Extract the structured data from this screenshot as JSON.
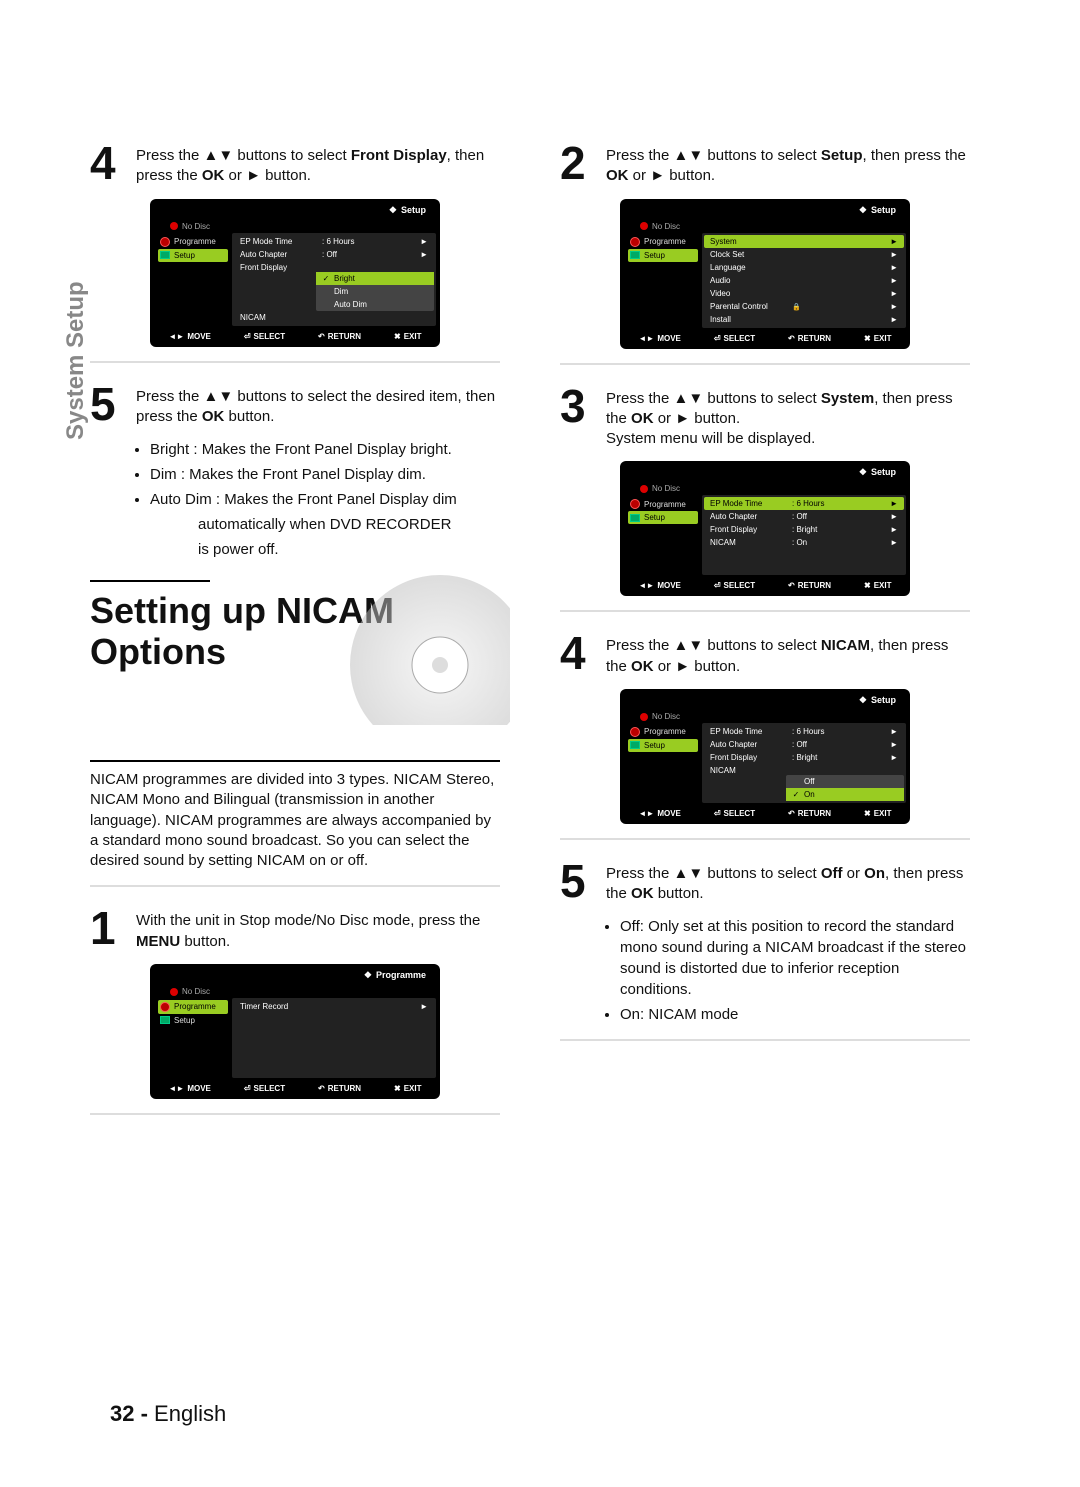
{
  "sideTab": "System Setup",
  "page": {
    "number": "32 -",
    "language": "English"
  },
  "icons": {
    "updown": "▲▼",
    "right": "►",
    "diamond": "❖"
  },
  "footer": {
    "move": "MOVE",
    "movesym": "◄►",
    "select": "SELECT",
    "selectsym": "⏎",
    "return": "RETURN",
    "returnsym": "↶",
    "exit": "EXIT",
    "exitsym": "✖"
  },
  "osdLabels": {
    "noDisc": "No Disc",
    "programme": "Programme",
    "setup": "Setup",
    "setupTitle": "Setup",
    "programmeTitle": "Programme",
    "system": "System",
    "clockSet": "Clock Set",
    "language": "Language",
    "audio": "Audio",
    "video": "Video",
    "parental": "Parental Control",
    "install": "Install",
    "timerRecord": "Timer Record",
    "epMode": "EP Mode Time",
    "autoChapter": "Auto Chapter",
    "frontDisplay": "Front Display",
    "nicam": "NICAM",
    "bright": "Bright",
    "dim": "Dim",
    "autoDim": "Auto Dim",
    "off": "Off",
    "on": "On",
    "v6h": ": 6 Hours",
    "vOff": ": Off",
    "vBright": ": Bright",
    "vOn": ": On"
  },
  "left": {
    "s4": {
      "num": "4",
      "pre": "Press the ",
      "mid1": " buttons to select ",
      "bold1": "Front Display",
      "mid2": ", then press the ",
      "bold2": "OK",
      "mid3": " or ",
      "mid4": " button."
    },
    "s5": {
      "num": "5",
      "pre": "Press the ",
      "mid1": " buttons to select the desired item, then press the ",
      "bold1": "OK",
      "mid2": " button."
    },
    "bullets": {
      "b1b": "Bright",
      "b1": " : Makes the Front Panel Display bright.",
      "b2b": "Dim",
      "b2": " : Makes the Front Panel Display dim.",
      "b3b": "Auto Dim",
      "b3": " : Makes the Front Panel Display dim",
      "b3c1": "automatically when DVD RECORDER",
      "b3c2": "is power off."
    },
    "heading": "Setting up NICAM Options",
    "intro": "NICAM programmes are divided into 3 types. NICAM Stereo, NICAM Mono and Bilingual (transmission in another language). NICAM programmes are always accompanied by a standard mono sound broadcast. So you can select the desired sound by setting NICAM on or off.",
    "s1": {
      "num": "1",
      "pre": "With the unit in Stop mode/No Disc mode, press the ",
      "bold": "MENU",
      "post": " button."
    }
  },
  "right": {
    "s2": {
      "num": "2",
      "pre": "Press the ",
      "mid1": " buttons to select ",
      "bold1": "Setup",
      "mid2": ", then press the ",
      "bold2": "OK",
      "mid3": " or ",
      "mid4": " button."
    },
    "s3": {
      "num": "3",
      "pre": "Press the ",
      "mid1": " buttons to select ",
      "bold1": "System",
      "mid2": ", then press the ",
      "bold2": "OK",
      "mid3": " or ",
      "mid4": " button.",
      "extra": "System menu will be displayed."
    },
    "s4": {
      "num": "4",
      "pre": "Press the ",
      "mid1": " buttons to select ",
      "bold1": "NICAM",
      "mid2": ", then press the ",
      "bold2": "OK",
      "mid3": " or ",
      "mid4": " button."
    },
    "s5": {
      "num": "5",
      "pre": "Press the ",
      "mid1": " buttons to select ",
      "bold1": "Off",
      "mid2": " or ",
      "bold2": "On",
      "mid3": ", then press the ",
      "bold3": "OK",
      "mid4": " button."
    },
    "bullets": {
      "offb": "Off",
      "off": ": Only set at this position to record the standard mono sound during a NICAM broadcast if the stereo sound is distorted due to inferior reception conditions.",
      "onb": "On",
      "on": ": NICAM mode"
    }
  }
}
